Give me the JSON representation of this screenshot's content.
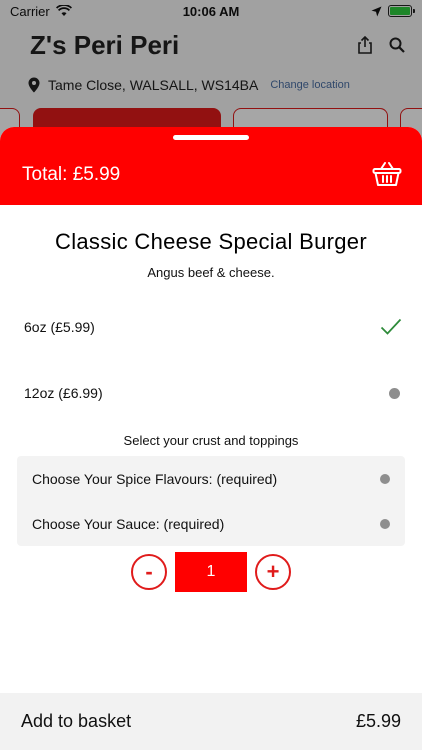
{
  "status": {
    "carrier": "Carrier",
    "time": "10:06 AM"
  },
  "restaurant": {
    "name": "Z's Peri Peri",
    "location": "Tame Close, WALSALL, WS14BA",
    "change_location": "Change location"
  },
  "sheet": {
    "total": "Total: £5.99",
    "title": "Classic Cheese Special Burger",
    "description": "Angus beef & cheese.",
    "options": [
      {
        "label": "6oz (£5.99)",
        "selected": true
      },
      {
        "label": "12oz (£6.99)",
        "selected": false
      }
    ],
    "section_label": "Select your crust and toppings",
    "choices": [
      {
        "label": "Choose Your Spice Flavours: (required)"
      },
      {
        "label": "Choose Your Sauce: (required)"
      }
    ],
    "quantity": "1",
    "minus": "-",
    "plus": "+"
  },
  "footer": {
    "label": "Add to basket",
    "price": "£5.99"
  },
  "colors": {
    "accent": "#ff0000",
    "check": "#2e8b3a",
    "dot": "#8e8e8e"
  }
}
